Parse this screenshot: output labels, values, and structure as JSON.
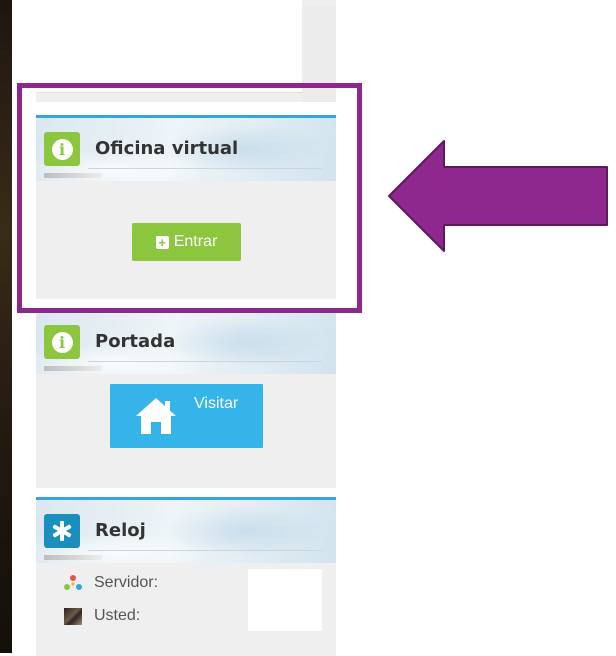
{
  "page": {
    "accent_color": "#35a6dd",
    "background_strip_color": "#2a1f15"
  },
  "panels": {
    "oficina": {
      "title": "Oficina virtual",
      "icon": "info-icon",
      "icon_color": "#8cc63e",
      "button_label": "Entrar",
      "button_icon": "plus-square-icon",
      "button_color": "#8cc63e"
    },
    "portada": {
      "title": "Portada",
      "icon": "info-icon",
      "icon_color": "#8cc63e",
      "button_label": "Visitar",
      "button_icon": "home-icon",
      "button_color": "#35b4ea"
    },
    "reloj": {
      "title": "Reloj",
      "icon": "asterisk-icon",
      "icon_color": "#1a8fbe",
      "rows": [
        {
          "label": "Servidor:",
          "icon": "network-dots-icon"
        },
        {
          "label": "Usted:",
          "icon": "user-photo-icon"
        }
      ]
    }
  },
  "annotation": {
    "highlight_color": "#8b278e",
    "arrow_icon": "left-arrow-icon",
    "arrow_color": "#8b278e"
  }
}
